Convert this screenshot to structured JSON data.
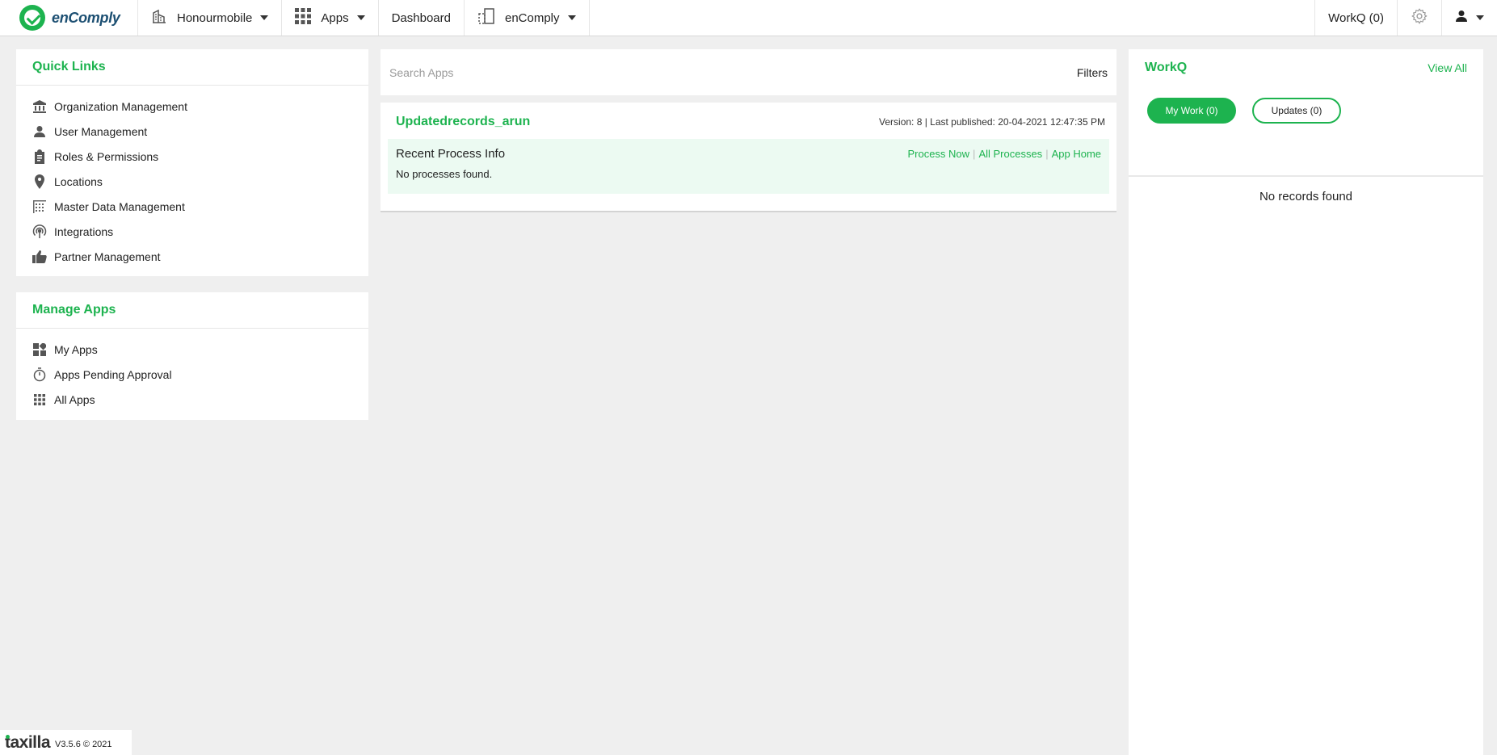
{
  "header": {
    "brand_name": "enComply",
    "org": "Honourmobile",
    "apps": "Apps",
    "dashboard": "Dashboard",
    "app_switch": "enComply",
    "workq": "WorkQ (0)"
  },
  "quick_links": {
    "title": "Quick Links",
    "items": [
      {
        "label": "Organization Management",
        "icon": "bank-icon"
      },
      {
        "label": "User Management",
        "icon": "user-icon"
      },
      {
        "label": "Roles & Permissions",
        "icon": "clipboard-icon"
      },
      {
        "label": "Locations",
        "icon": "map-pin-icon"
      },
      {
        "label": "Master Data Management",
        "icon": "grid-data-icon"
      },
      {
        "label": "Integrations",
        "icon": "broadcast-icon"
      },
      {
        "label": "Partner Management",
        "icon": "thumbs-up-icon"
      }
    ]
  },
  "manage_apps": {
    "title": "Manage Apps",
    "items": [
      {
        "label": "My Apps",
        "icon": "widgets-icon"
      },
      {
        "label": "Apps Pending Approval",
        "icon": "timer-icon"
      },
      {
        "label": "All Apps",
        "icon": "apps-grid-icon"
      }
    ]
  },
  "search": {
    "placeholder": "Search Apps",
    "filters": "Filters"
  },
  "app_card": {
    "title": "Updatedrecords_arun",
    "meta": "Version: 8 | Last published: 20-04-2021 12:47:35 PM",
    "process_title": "Recent Process Info",
    "links": [
      "Process Now",
      "All Processes",
      "App Home"
    ],
    "empty": "No processes found."
  },
  "workq_panel": {
    "title": "WorkQ",
    "view_all": "View All",
    "tab_my_work": "My Work (0)",
    "tab_updates": "Updates (0)",
    "empty": "No records found"
  },
  "footer": {
    "logo": "taxilla",
    "version": "V3.5.6 © 2021"
  },
  "colors": {
    "accent": "#1db34f",
    "background": "#efefef"
  }
}
